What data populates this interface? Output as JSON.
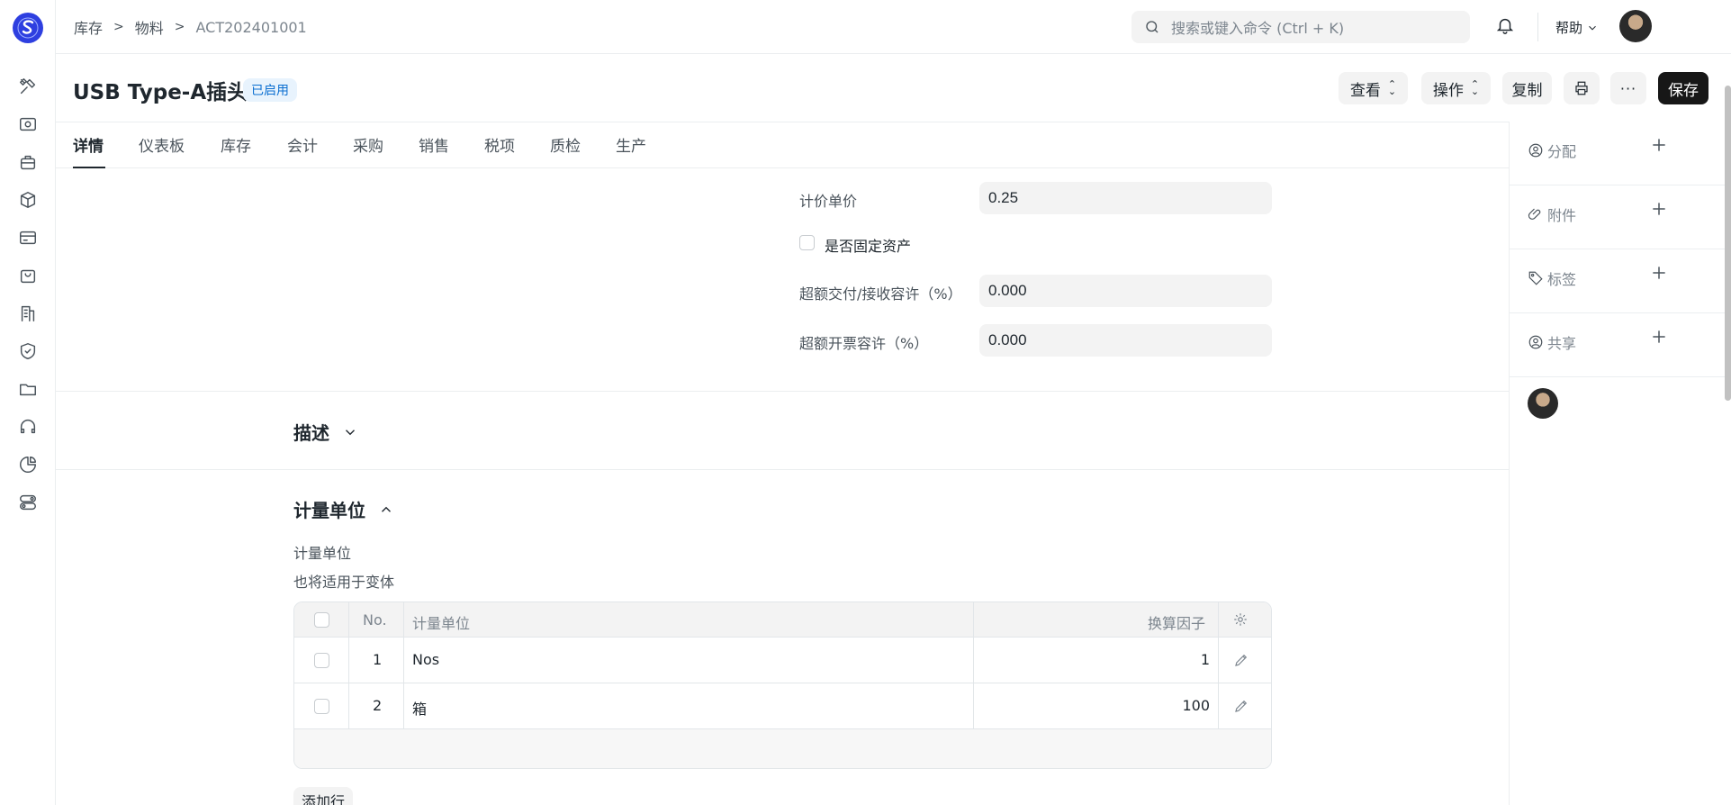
{
  "breadcrumb": [
    "库存",
    "物料",
    "ACT202401001"
  ],
  "search": {
    "placeholder": "搜索或键入命令 (Ctrl + K)"
  },
  "help_label": "帮助",
  "rail_icons": [
    "tools-icon",
    "eye-icon",
    "briefcase-icon",
    "box-icon",
    "card-icon",
    "bag-icon",
    "building-icon",
    "shield-icon",
    "folder-icon",
    "headset-icon",
    "pie-chart-icon",
    "toggles-icon"
  ],
  "doc": {
    "title": "USB Type-A插头",
    "status": "已启用"
  },
  "actions": {
    "view": "查看",
    "operate": "操作",
    "copy": "复制",
    "save": "保存"
  },
  "tabs": [
    "详情",
    "仪表板",
    "库存",
    "会计",
    "采购",
    "销售",
    "税项",
    "质检",
    "生产"
  ],
  "fields": {
    "valuation_rate": {
      "label": "计价单价",
      "value": "0.25"
    },
    "is_fixed_asset": {
      "label": "是否固定资产"
    },
    "over_delivery": {
      "label": "超额交付/接收容许（%）",
      "value": "0.000"
    },
    "over_billing": {
      "label": "超额开票容许（%）",
      "value": "0.000"
    }
  },
  "sections": {
    "description": "描述",
    "uom": "计量单位",
    "uom_label": "计量单位",
    "uom_hint": "也将适用于变体"
  },
  "uom_table": {
    "headers": {
      "no": "No.",
      "uom": "计量单位",
      "factor": "换算因子"
    },
    "rows": [
      {
        "no": "1",
        "uom": "Nos",
        "factor": "1"
      },
      {
        "no": "2",
        "uom": "箱",
        "factor": "100"
      }
    ],
    "add_row": "添加行"
  },
  "sidebar": {
    "assign": "分配",
    "attachments": "附件",
    "tags": "标签",
    "share": "共享"
  }
}
